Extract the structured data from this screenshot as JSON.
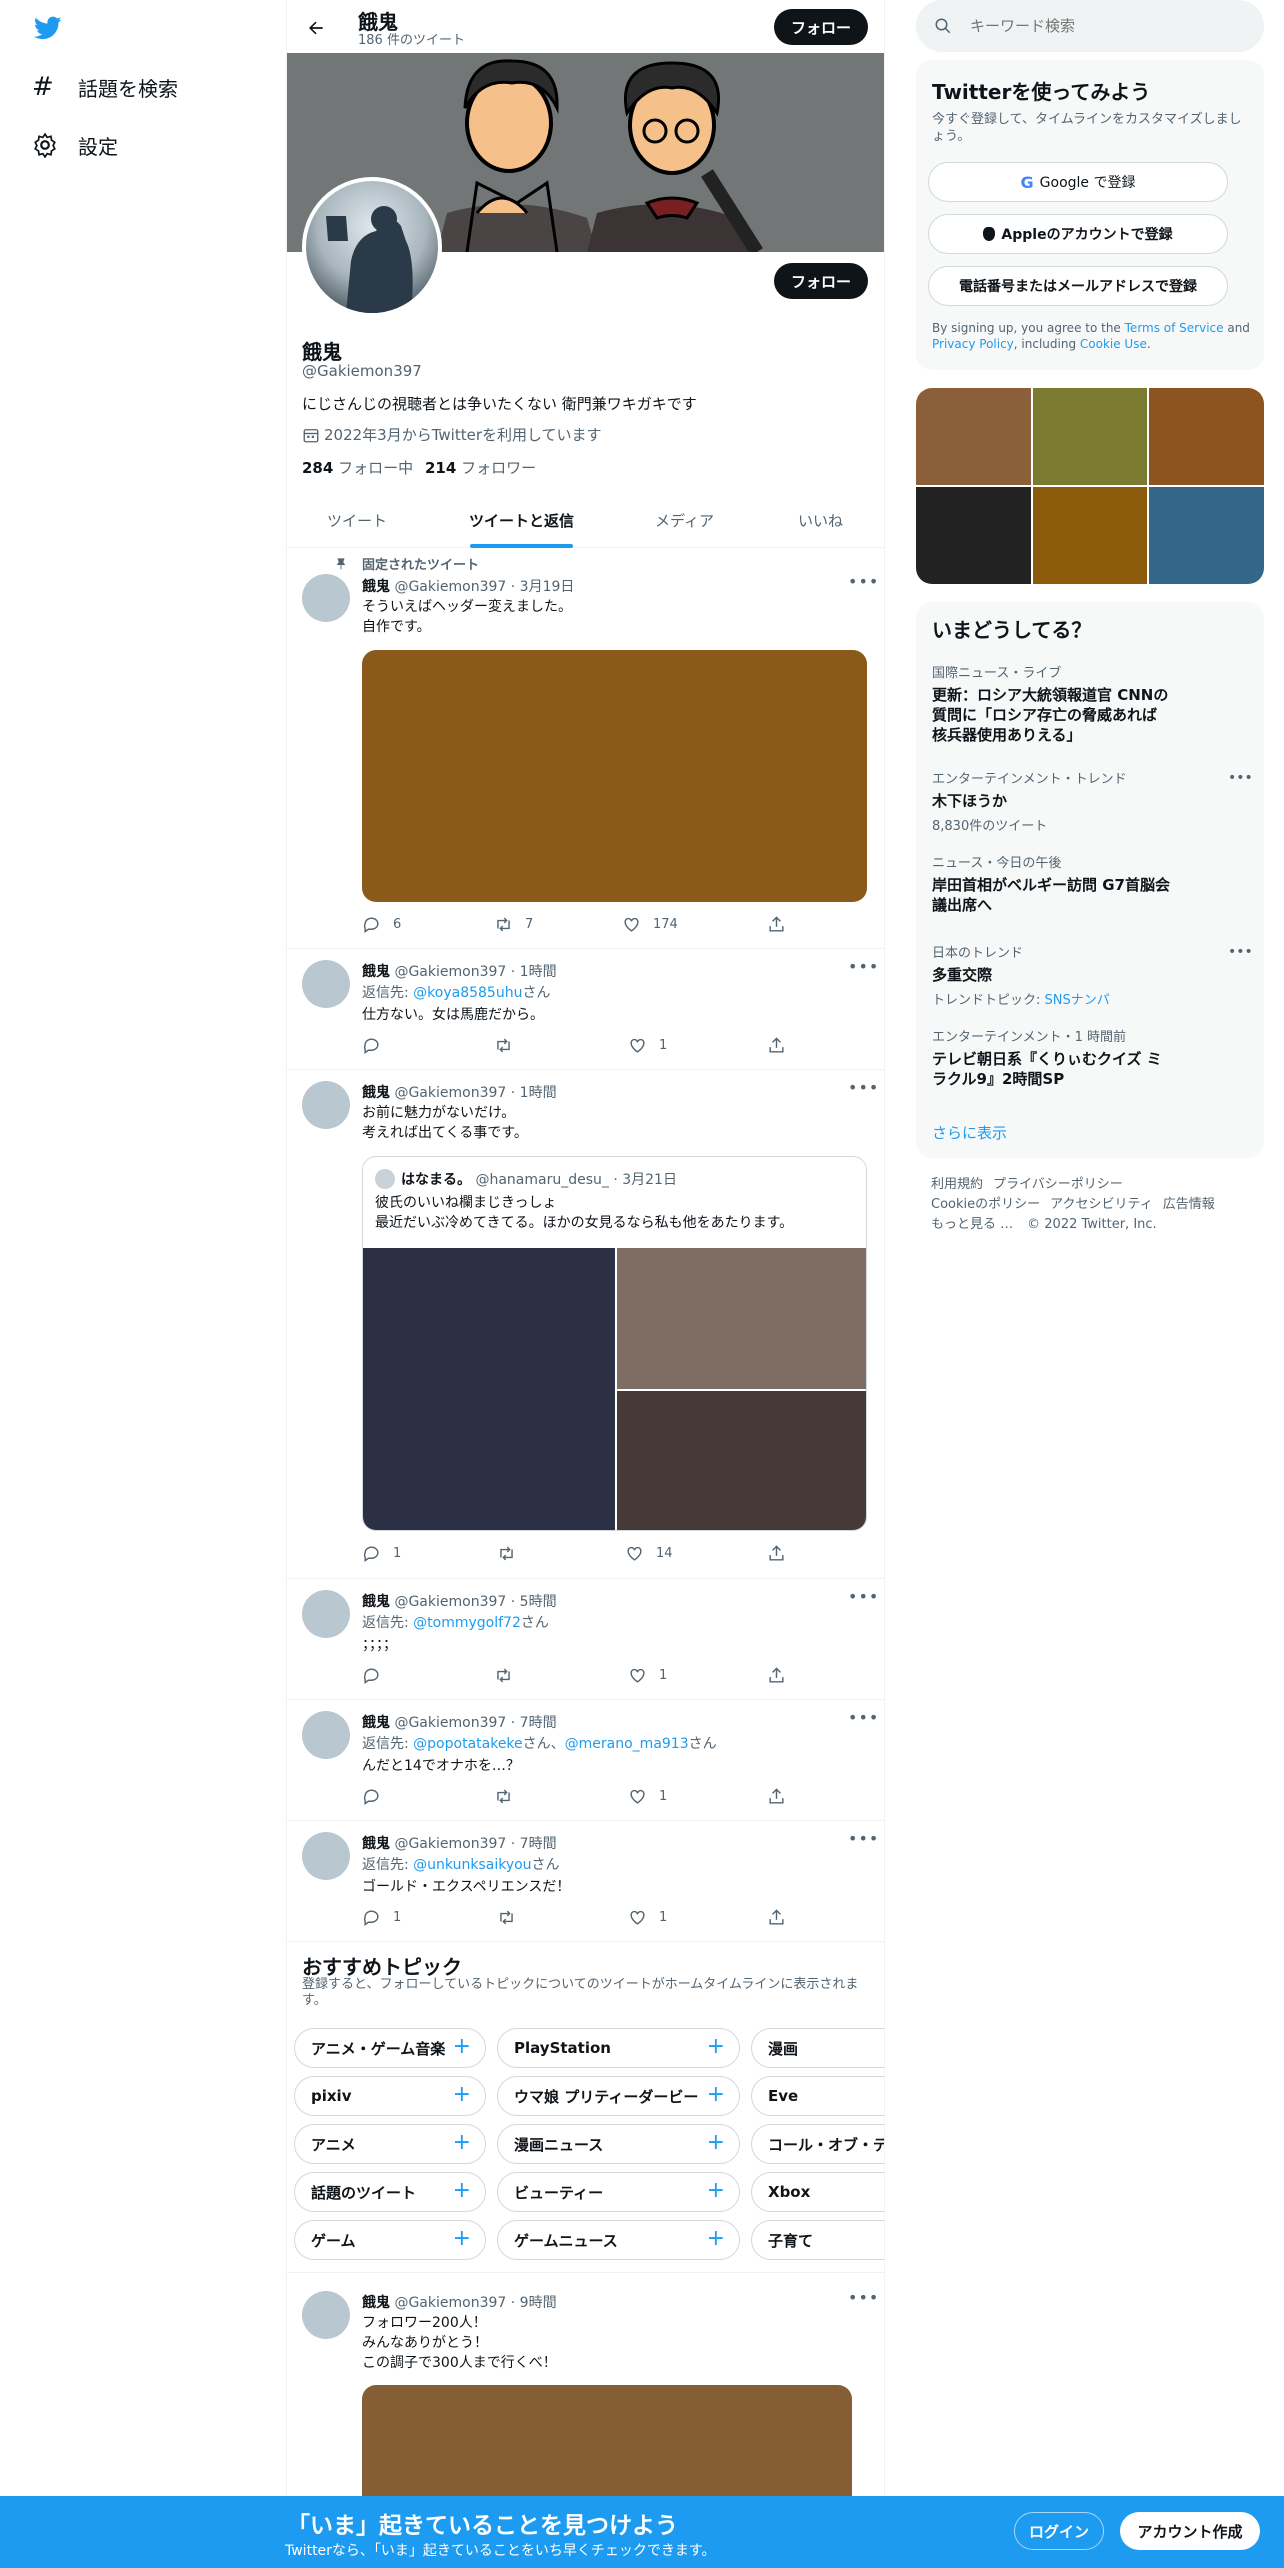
{
  "nav": {
    "explore_label": "話題を検索",
    "settings_label": "設定"
  },
  "header": {
    "name": "餓鬼",
    "tweet_count": "186 件のツイート",
    "follow_label": "フォロー"
  },
  "profile": {
    "name": "餓鬼",
    "handle": "@Gakiemon397",
    "bio": "にじさんじの視聴者とは争いたくない 衛門兼ワキガキです",
    "joined": "2022年3月からTwitterを利用しています",
    "following_count": "284",
    "following_label": "フォロー中",
    "followers_count": "214",
    "followers_label": "フォロワー",
    "follow_label": "フォロー"
  },
  "tabs": [
    "ツイート",
    "ツイートと返信",
    "メディア",
    "いいね"
  ],
  "pinned_label": "固定されたツイート",
  "tweets": [
    {
      "name": "餓鬼",
      "handle": "@Gakiemon397",
      "time": "3月19日",
      "lines": [
        "そういえばヘッダー変えました。",
        "自作です。"
      ],
      "replies": "6",
      "retweets": "7",
      "likes": "174",
      "media_color": "#8b5a1b"
    },
    {
      "name": "餓鬼",
      "handle": "@Gakiemon397",
      "time": "1時間",
      "reply_prefix": "返信先: ",
      "reply_to": "@koya8585uhu",
      "reply_suffix": "さん",
      "lines": [
        "仕方ない。女は馬鹿だから。"
      ],
      "replies": "",
      "retweets": "",
      "likes": "1"
    },
    {
      "name": "餓鬼",
      "handle": "@Gakiemon397",
      "time": "1時間",
      "lines": [
        "お前に魅力がないだけ。",
        "考えれば出てくる事です。"
      ],
      "quote": {
        "name": "はなまる。",
        "handle": "@hanamaru_desu_",
        "time": "3月21日",
        "lines": [
          "彼氏のいいね欄まじきっしょ",
          "最近だいぶ冷めてきてる。ほかの女見るなら私も他をあたります。"
        ]
      },
      "replies": "1",
      "retweets": "",
      "likes": "14"
    },
    {
      "name": "餓鬼",
      "handle": "@Gakiemon397",
      "time": "5時間",
      "reply_prefix": "返信先: ",
      "reply_to": "@tommygolf72",
      "reply_suffix": "さん",
      "lines": [
        "；；；；"
      ],
      "replies": "",
      "retweets": "",
      "likes": "1"
    },
    {
      "name": "餓鬼",
      "handle": "@Gakiemon397",
      "time": "7時間",
      "reply_prefix": "返信先: ",
      "reply_to": "@popotatakeke",
      "reply_mid": "さん、",
      "reply_to2": "@merano_ma913",
      "reply_suffix": "さん",
      "lines": [
        "んだと14でオナホを…？"
      ],
      "replies": "",
      "retweets": "",
      "likes": "1"
    },
    {
      "name": "餓鬼",
      "handle": "@Gakiemon397",
      "time": "7時間",
      "reply_prefix": "返信先: ",
      "reply_to": "@unkunksaikyou",
      "reply_suffix": "さん",
      "lines": [
        "ゴールド・エクスペリエンスだ！"
      ],
      "replies": "1",
      "retweets": "",
      "likes": "1"
    },
    {
      "name": "餓鬼",
      "handle": "@Gakiemon397",
      "time": "9時間",
      "lines": [
        "フォロワー200人！",
        "みんなありがとう！",
        "この調子で300人まで行くべ！"
      ]
    }
  ],
  "topics": {
    "title": "おすすめトピック",
    "desc": "登録すると、フォローしているトピックについてのツイートがホームタイムラインに表示されます。",
    "rows": [
      [
        "アニメ・ゲーム音楽",
        "PlayStation",
        "漫画"
      ],
      [
        "pixiv",
        "ウマ娘 プリティーダービー",
        "Eve"
      ],
      [
        "アニメ",
        "漫画ニュース",
        "コール・オブ・デ"
      ],
      [
        "話題のツイート",
        "ビューティー",
        "Xbox"
      ],
      [
        "ゲーム",
        "ゲームニュース",
        "子育て"
      ]
    ]
  },
  "search": {
    "placeholder": "キーワード検索"
  },
  "signup": {
    "title": "Twitterを使ってみよう",
    "desc": "今すぐ登録して、タイムラインをカスタマイズしましょう。",
    "google": "Google で登録",
    "apple": "Appleのアカウントで登録",
    "phone": "電話番号またはメールアドレスで登録",
    "terms_1": "By signing up, you agree to the ",
    "terms_tos": "Terms of Service",
    "terms_2": " and ",
    "terms_privacy": "Privacy Policy",
    "terms_3": ", including ",
    "terms_cookie": "Cookie Use",
    "terms_4": "."
  },
  "media_grid": [
    "#8a5f3a",
    "#7a7a30",
    "#8b5420",
    "#222222",
    "#8b5a0a",
    "#336688"
  ],
  "trends": {
    "title": "いまどうしてる？",
    "items": [
      {
        "cat": "国際ニュース・ライブ",
        "lines": [
          "更新：ロシア大統領報道官 CNNの",
          "質問に「ロシア存亡の脅威あれば",
          "核兵器使用ありえる」"
        ],
        "count": ""
      },
      {
        "cat": "エンターテインメント・トレンド",
        "lines": [
          "木下ほうか"
        ],
        "count": "8,830件のツイート"
      },
      {
        "cat": "ニュース・今日の午後",
        "lines": [
          "岸田首相がベルギー訪問 G7首脳会",
          "議出席へ"
        ],
        "count": ""
      },
      {
        "cat": "日本のトレンド",
        "lines": [
          "多重交際"
        ],
        "count_prefix": "トレンドトピック: ",
        "count_link": "SNSナンパ"
      },
      {
        "cat": "エンターテインメント・1 時間前",
        "lines": [
          "テレビ朝日系『くりぃむクイズ ミ",
          "ラクル9』2時間SP"
        ],
        "count": ""
      }
    ],
    "more": "さらに表示"
  },
  "footer": {
    "row1": [
      "利用規約",
      "プライバシーポリシー"
    ],
    "row2": [
      "Cookieのポリシー",
      "アクセシビリティ",
      "広告情報"
    ],
    "row3": [
      "もっと見る …",
      "© 2022 Twitter, Inc."
    ]
  },
  "bottom_bar": {
    "title": "「いま」起きていることを見つけよう",
    "sub": "Twitterなら、「いま」起きていることをいち早くチェックできます。",
    "login": "ログイン",
    "signup": "アカウント作成",
    "bg": "#1d9bf0"
  }
}
